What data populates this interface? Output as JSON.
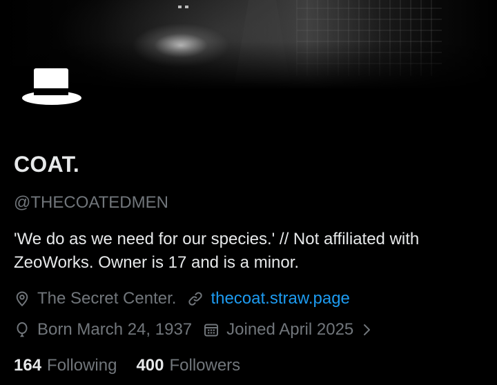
{
  "profile": {
    "display_name": "COAT.",
    "handle": "@THECOATEDMEN",
    "bio": "'We do as we need for our species.' // Not affiliated with ZeoWorks. Owner is 17 and is a minor.",
    "location": "The Secret Center.",
    "website": "thecoat.straw.page",
    "birthday": "Born March 24, 1937",
    "joined": "Joined April 2025"
  },
  "stats": {
    "following_count": "164",
    "following_label": "Following",
    "followers_count": "400",
    "followers_label": "Followers"
  },
  "colors": {
    "background": "#000000",
    "text_primary": "#e7e9ea",
    "text_secondary": "#71767b",
    "link": "#1d9bf0"
  },
  "icons": {
    "avatar": "top-hat-icon",
    "location": "location-pin-icon",
    "website": "link-icon",
    "birthday": "balloon-icon",
    "joined": "calendar-icon",
    "expand": "chevron-right-icon"
  }
}
